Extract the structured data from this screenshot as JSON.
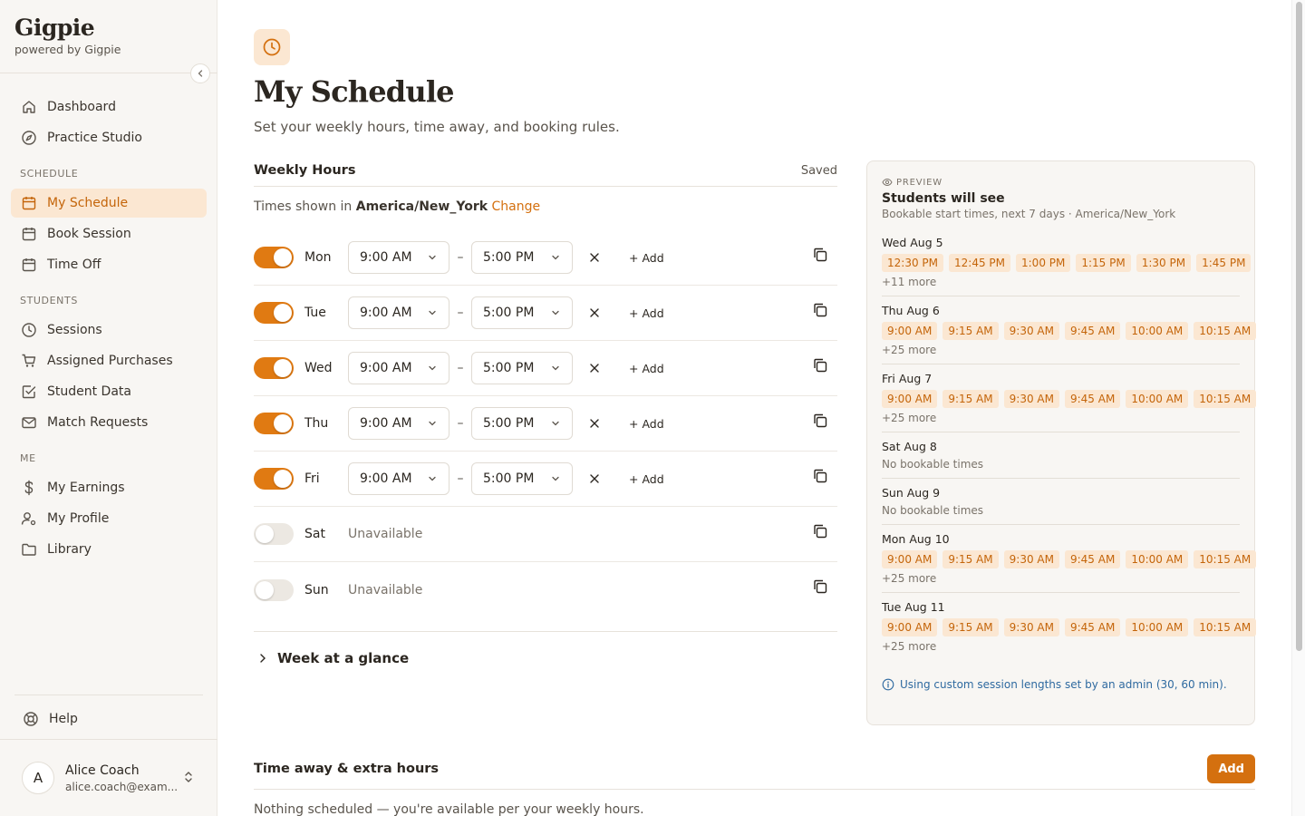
{
  "brand": {
    "name": "Gigpie",
    "sub": "powered by Gigpie"
  },
  "nav": {
    "top": [
      {
        "label": "Dashboard",
        "icon": "home-icon"
      },
      {
        "label": "Practice Studio",
        "icon": "compass-icon"
      }
    ],
    "schedule_heading": "SCHEDULE",
    "schedule": [
      {
        "label": "My Schedule",
        "icon": "calendar-icon",
        "active": true
      },
      {
        "label": "Book Session",
        "icon": "calendar-icon"
      },
      {
        "label": "Time Off",
        "icon": "calendar-icon"
      }
    ],
    "students_heading": "STUDENTS",
    "students": [
      {
        "label": "Sessions",
        "icon": "clock-icon"
      },
      {
        "label": "Assigned Purchases",
        "icon": "cart-icon"
      },
      {
        "label": "Student Data",
        "icon": "checkbox-icon"
      },
      {
        "label": "Match Requests",
        "icon": "mail-icon"
      }
    ],
    "me_heading": "ME",
    "me": [
      {
        "label": "My Earnings",
        "icon": "dollar-icon"
      },
      {
        "label": "My Profile",
        "icon": "user-gear-icon"
      },
      {
        "label": "Library",
        "icon": "folder-icon"
      }
    ],
    "help": "Help"
  },
  "user": {
    "initial": "A",
    "name": "Alice Coach",
    "email": "alice.coach@exam..."
  },
  "page": {
    "title": "My Schedule",
    "subtitle": "Set your weekly hours, time away, and booking rules."
  },
  "weekly": {
    "title": "Weekly Hours",
    "status": "Saved",
    "tz_prefix": "Times shown in ",
    "tz": "America/New_York",
    "tz_change": "Change",
    "add_label": "+ Add",
    "dash": "–",
    "unavailable": "Unavailable",
    "days": [
      {
        "name": "Mon",
        "on": true,
        "start": "9:00 AM",
        "end": "5:00 PM"
      },
      {
        "name": "Tue",
        "on": true,
        "start": "9:00 AM",
        "end": "5:00 PM"
      },
      {
        "name": "Wed",
        "on": true,
        "start": "9:00 AM",
        "end": "5:00 PM"
      },
      {
        "name": "Thu",
        "on": true,
        "start": "9:00 AM",
        "end": "5:00 PM"
      },
      {
        "name": "Fri",
        "on": true,
        "start": "9:00 AM",
        "end": "5:00 PM"
      },
      {
        "name": "Sat",
        "on": false
      },
      {
        "name": "Sun",
        "on": false
      }
    ],
    "glance": "Week at a glance"
  },
  "preview": {
    "label": "PREVIEW",
    "title": "Students will see",
    "subtitle": "Bookable start times, next 7 days · America/New_York",
    "days": [
      {
        "date": "Wed Aug 5",
        "times": [
          "12:30 PM",
          "12:45 PM",
          "1:00 PM",
          "1:15 PM",
          "1:30 PM",
          "1:45 PM"
        ],
        "more": "+11 more"
      },
      {
        "date": "Thu Aug 6",
        "times": [
          "9:00 AM",
          "9:15 AM",
          "9:30 AM",
          "9:45 AM",
          "10:00 AM",
          "10:15 AM"
        ],
        "more": "+25 more"
      },
      {
        "date": "Fri Aug 7",
        "times": [
          "9:00 AM",
          "9:15 AM",
          "9:30 AM",
          "9:45 AM",
          "10:00 AM",
          "10:15 AM"
        ],
        "more": "+25 more"
      },
      {
        "date": "Sat Aug 8",
        "times": [],
        "none": "No bookable times"
      },
      {
        "date": "Sun Aug 9",
        "times": [],
        "none": "No bookable times"
      },
      {
        "date": "Mon Aug 10",
        "times": [
          "9:00 AM",
          "9:15 AM",
          "9:30 AM",
          "9:45 AM",
          "10:00 AM",
          "10:15 AM"
        ],
        "more": "+25 more"
      },
      {
        "date": "Tue Aug 11",
        "times": [
          "9:00 AM",
          "9:15 AM",
          "9:30 AM",
          "9:45 AM",
          "10:00 AM",
          "10:15 AM"
        ],
        "more": "+25 more"
      }
    ],
    "note": "Using custom session lengths set by an admin (30, 60 min)."
  },
  "away": {
    "title": "Time away & extra hours",
    "add_button": "Add",
    "empty": "Nothing scheduled — you're available per your weekly hours."
  },
  "colors": {
    "accent": "#e07a12",
    "accent_soft": "#fbe7d2",
    "link": "#2f6aa0"
  }
}
